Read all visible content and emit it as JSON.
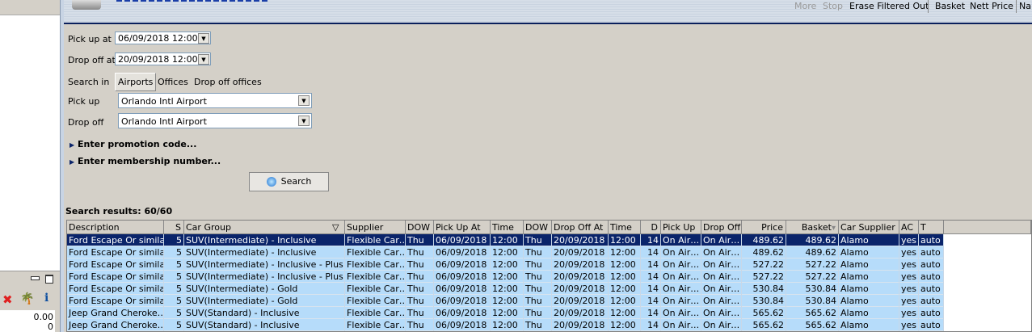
{
  "toolbar": {
    "more": "More",
    "stop": "Stop",
    "erase": "Erase Filtered Out",
    "basket": "Basket",
    "nett_price": "Nett Price",
    "na": "Na"
  },
  "form": {
    "pickup_at_label": "Pick up at",
    "pickup_at_value": "06/09/2018 12:00",
    "dropoff_at_label": "Drop off at",
    "dropoff_at_value": "20/09/2018 12:00",
    "search_in_label": "Search in",
    "search_in_options": [
      "Airports",
      "Offices",
      "Drop off offices"
    ],
    "pickup_label": "Pick up",
    "pickup_value": "Orlando Intl Airport",
    "dropoff_label": "Drop off",
    "dropoff_value": "Orlando Intl Airport",
    "promo": "Enter promotion code...",
    "membership": "Enter membership number...",
    "search_button": "Search"
  },
  "results_label": "Search results: 60/60",
  "left_panel": {
    "value1": "0.00",
    "value2": "0"
  },
  "grid": {
    "columns": [
      "Description",
      "S",
      "Car Group",
      "Supplier",
      "DOW",
      "Pick Up At",
      "Time",
      "DOW",
      "Drop Off At",
      "Time",
      "D",
      "Pick Up",
      "Drop Off",
      "Price",
      "Basket",
      "Car Supplier",
      "AC",
      "T"
    ],
    "rows": [
      [
        "Ford Escape Or simila…",
        "5",
        "SUV(Intermediate) - Inclusive",
        "Flexible Car…",
        "Thu",
        "06/09/2018",
        "12:00",
        "Thu",
        "20/09/2018",
        "12:00",
        "14",
        "On Air…",
        "On Air…",
        "489.62",
        "489.62",
        "Alamo",
        "yes",
        "auto"
      ],
      [
        "Ford Escape Or simila…",
        "5",
        "SUV(Intermediate) - Inclusive",
        "Flexible Car…",
        "Thu",
        "06/09/2018",
        "12:00",
        "Thu",
        "20/09/2018",
        "12:00",
        "14",
        "On Air…",
        "On Air…",
        "489.62",
        "489.62",
        "Alamo",
        "yes",
        "auto"
      ],
      [
        "Ford Escape Or simila…",
        "5",
        "SUV(Intermediate) - Inclusive - Plus E…",
        "Flexible Car…",
        "Thu",
        "06/09/2018",
        "12:00",
        "Thu",
        "20/09/2018",
        "12:00",
        "14",
        "On Air…",
        "On Air…",
        "527.22",
        "527.22",
        "Alamo",
        "yes",
        "auto"
      ],
      [
        "Ford Escape Or simila…",
        "5",
        "SUV(Intermediate) - Inclusive - Plus E…",
        "Flexible Car…",
        "Thu",
        "06/09/2018",
        "12:00",
        "Thu",
        "20/09/2018",
        "12:00",
        "14",
        "On Air…",
        "On Air…",
        "527.22",
        "527.22",
        "Alamo",
        "yes",
        "auto"
      ],
      [
        "Ford Escape Or simila…",
        "5",
        "SUV(Intermediate) - Gold",
        "Flexible Car…",
        "Thu",
        "06/09/2018",
        "12:00",
        "Thu",
        "20/09/2018",
        "12:00",
        "14",
        "On Air…",
        "On Air…",
        "530.84",
        "530.84",
        "Alamo",
        "yes",
        "auto"
      ],
      [
        "Ford Escape Or simila…",
        "5",
        "SUV(Intermediate) - Gold",
        "Flexible Car…",
        "Thu",
        "06/09/2018",
        "12:00",
        "Thu",
        "20/09/2018",
        "12:00",
        "14",
        "On Air…",
        "On Air…",
        "530.84",
        "530.84",
        "Alamo",
        "yes",
        "auto"
      ],
      [
        "Jeep Grand Cheroke…",
        "5",
        "SUV(Standard) - Inclusive",
        "Flexible Car…",
        "Thu",
        "06/09/2018",
        "12:00",
        "Thu",
        "20/09/2018",
        "12:00",
        "14",
        "On Air…",
        "On Air…",
        "565.62",
        "565.62",
        "Alamo",
        "yes",
        "auto"
      ],
      [
        "Jeep Grand Cheroke…",
        "5",
        "SUV(Standard) - Inclusive",
        "Flexible Car…",
        "Thu",
        "06/09/2018",
        "12:00",
        "Thu",
        "20/09/2018",
        "12:00",
        "14",
        "On Air…",
        "On Air…",
        "565.62",
        "565.62",
        "Alamo",
        "yes",
        "auto"
      ]
    ],
    "selected_row": 0
  },
  "colors": {
    "selection": "#0a246a",
    "row": "#b6dcfa",
    "header_line": "#0a1f5c"
  }
}
